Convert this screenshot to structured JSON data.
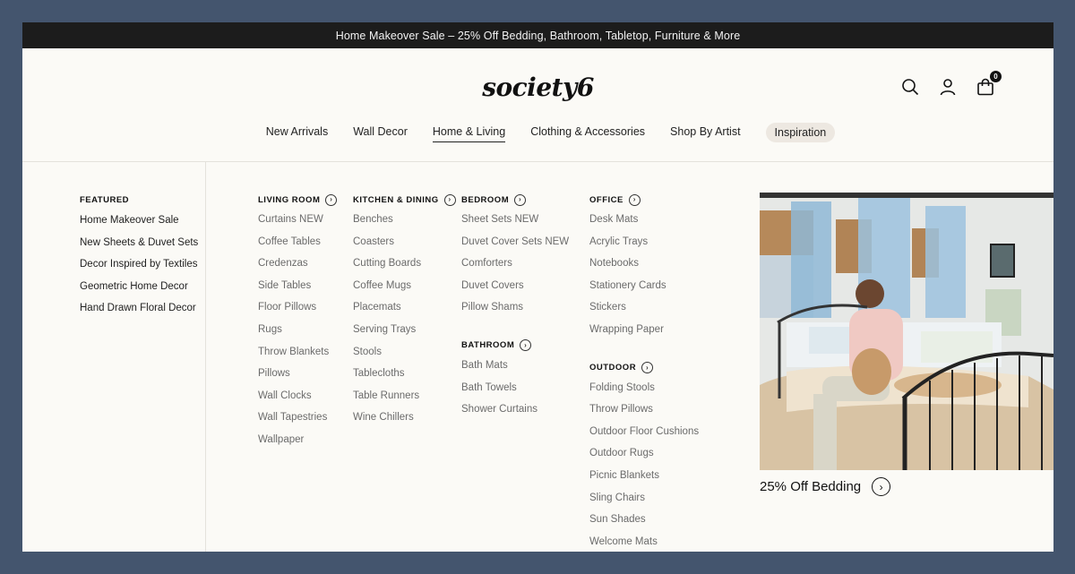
{
  "promo_banner": "Home Makeover Sale – 25% Off Bedding, Bathroom, Tabletop, Furniture & More",
  "logo": "society6",
  "cart_count": "0",
  "icons": {
    "search": "search-icon",
    "account": "user-icon",
    "cart": "shopping-bag-icon"
  },
  "nav": [
    "New Arrivals",
    "Wall Decor",
    "Home & Living",
    "Clothing & Accessories",
    "Shop By Artist",
    "Inspiration"
  ],
  "featured": {
    "title": "FEATURED",
    "links": [
      "Home Makeover Sale",
      "New Sheets & Duvet Sets",
      "Decor Inspired by Textiles",
      "Geometric Home Decor",
      "Hand Drawn Floral Decor"
    ]
  },
  "living_room": {
    "title": "LIVING ROOM",
    "links": [
      "Curtains NEW",
      "Coffee Tables",
      "Credenzas",
      "Side Tables",
      "Floor Pillows",
      "Rugs",
      "Throw Blankets",
      "Pillows",
      "Wall Clocks",
      "Wall Tapestries",
      "Wallpaper"
    ]
  },
  "kitchen_dining": {
    "title": "KITCHEN & DINING",
    "links": [
      "Benches",
      "Coasters",
      "Cutting Boards",
      "Coffee Mugs",
      "Placemats",
      "Serving Trays",
      "Stools",
      "Tablecloths",
      "Table Runners",
      "Wine Chillers"
    ]
  },
  "bedroom": {
    "title": "BEDROOM",
    "links": [
      "Sheet Sets NEW",
      "Duvet Cover Sets NEW",
      "Comforters",
      "Duvet Covers",
      "Pillow Shams"
    ]
  },
  "bathroom": {
    "title": "BATHROOM",
    "links": [
      "Bath Mats",
      "Bath Towels",
      "Shower Curtains"
    ]
  },
  "office": {
    "title": "OFFICE",
    "links": [
      "Desk Mats",
      "Acrylic Trays",
      "Notebooks",
      "Stationery Cards",
      "Stickers",
      "Wrapping Paper"
    ]
  },
  "outdoor": {
    "title": "OUTDOOR",
    "links": [
      "Folding Stools",
      "Throw Pillows",
      "Outdoor Floor Cushions",
      "Outdoor Rugs",
      "Picnic Blankets",
      "Sling Chairs",
      "Sun Shades",
      "Welcome Mats"
    ]
  },
  "promo_card": {
    "label": "25% Off Bedding"
  },
  "colors": {
    "banner_bg": "#1c1c1c",
    "page_bg": "#fbfaf6",
    "outer_bg": "#44556e",
    "pill_bg": "#ede8e1",
    "muted_link": "#6b6b6b"
  }
}
